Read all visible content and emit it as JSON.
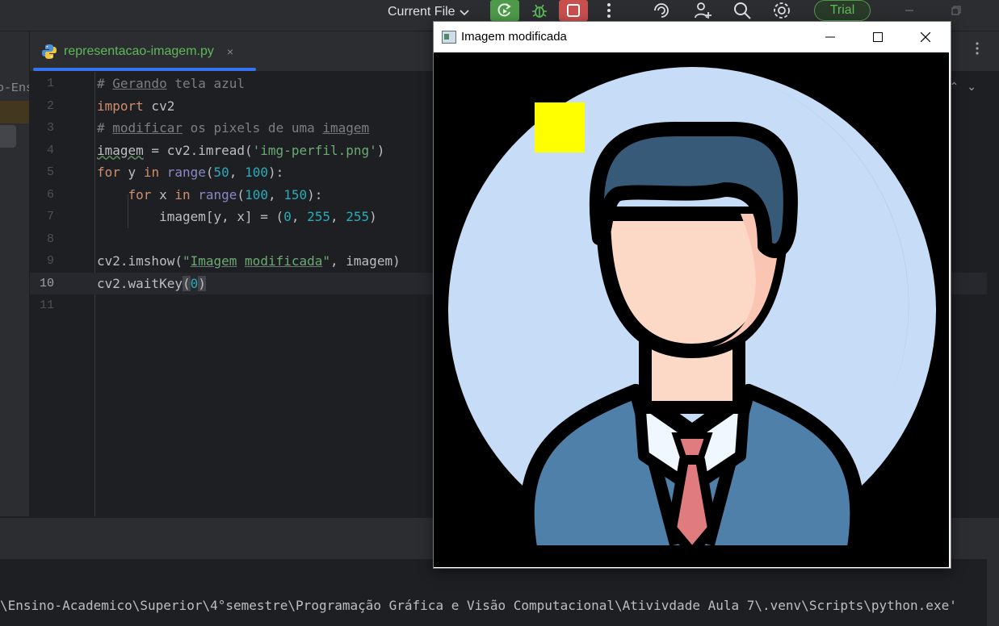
{
  "toolbar": {
    "run_config": "Current File",
    "trial_label": "Trial"
  },
  "project_fragment": "o-Ens",
  "tab": {
    "filename": "representacao-imagem.py",
    "close": "×"
  },
  "editor": {
    "current_line": 10,
    "line_numbers": [
      "1",
      "2",
      "3",
      "4",
      "5",
      "6",
      "7",
      "8",
      "9",
      "10",
      "11"
    ]
  },
  "terminal": {
    "path_text": "\\Ensino-Academico\\Superior\\4°semestre\\Programação Gráfica e Visão Computacional\\Ativivdade Aula 7\\.venv\\Scripts\\python.exe'"
  },
  "cv_window": {
    "title": "Imagem modificada",
    "minimize": "—",
    "maximize": "☐",
    "close": "✕"
  },
  "colors": {
    "accent_green": "#5fb85a",
    "accent_red": "#c94f4f",
    "keyword": "#cf8e6d",
    "string": "#6aab73",
    "number": "#2aacb8",
    "comment": "#7a7e85",
    "marker_yellow": "#ffff00"
  },
  "icons": [
    "chevron-down-icon",
    "rerun-icon",
    "debug-icon",
    "stop-icon",
    "more-vertical-icon",
    "copilot-icon",
    "add-user-icon",
    "search-icon",
    "settings-icon",
    "python-file-icon",
    "close-icon",
    "minimize-icon",
    "maximize-icon"
  ]
}
